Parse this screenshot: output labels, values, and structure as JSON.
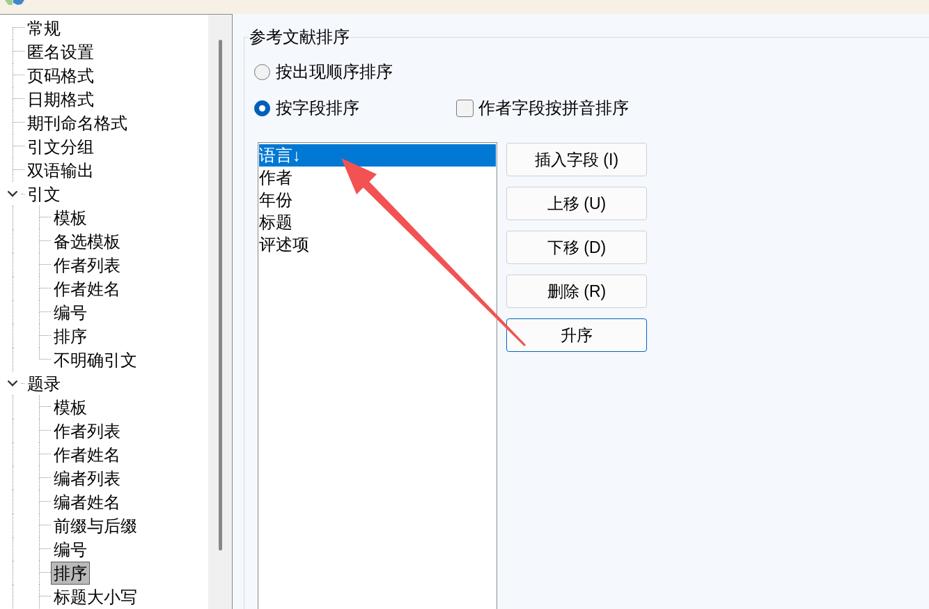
{
  "tree": {
    "items": [
      {
        "label": "常规",
        "selected": false
      },
      {
        "label": "匿名设置",
        "selected": false
      },
      {
        "label": "页码格式",
        "selected": false
      },
      {
        "label": "日期格式",
        "selected": false
      },
      {
        "label": "期刊命名格式",
        "selected": false
      },
      {
        "label": "引文分组",
        "selected": false
      },
      {
        "label": "双语输出",
        "selected": false
      },
      {
        "label": "引文",
        "selected": false,
        "expanded": true,
        "children": [
          {
            "label": "模板",
            "selected": false
          },
          {
            "label": "备选模板",
            "selected": false
          },
          {
            "label": "作者列表",
            "selected": false
          },
          {
            "label": "作者姓名",
            "selected": false
          },
          {
            "label": "编号",
            "selected": false
          },
          {
            "label": "排序",
            "selected": false
          },
          {
            "label": "不明确引文",
            "selected": false
          }
        ]
      },
      {
        "label": "题录",
        "selected": false,
        "expanded": true,
        "children": [
          {
            "label": "模板",
            "selected": false
          },
          {
            "label": "作者列表",
            "selected": false
          },
          {
            "label": "作者姓名",
            "selected": false
          },
          {
            "label": "编者列表",
            "selected": false
          },
          {
            "label": "编者姓名",
            "selected": false
          },
          {
            "label": "前缀与后缀",
            "selected": false
          },
          {
            "label": "编号",
            "selected": false
          },
          {
            "label": "排序",
            "selected": true
          },
          {
            "label": "标题大小写",
            "selected": false
          }
        ]
      }
    ]
  },
  "sort_group": {
    "title": "参考文献排序",
    "options": [
      {
        "label": "按出现顺序排序",
        "selected": false
      },
      {
        "label": "按字段排序",
        "selected": true
      }
    ],
    "pinyin_checkbox": {
      "label": "作者字段按拼音排序",
      "checked": false
    },
    "fields": [
      {
        "label": "语言↓",
        "selected": true
      },
      {
        "label": "作者",
        "selected": false
      },
      {
        "label": "年份",
        "selected": false
      },
      {
        "label": "标题",
        "selected": false
      },
      {
        "label": "评述项",
        "selected": false
      }
    ],
    "buttons": [
      {
        "label": "插入字段 (I)",
        "focused": false
      },
      {
        "label": "上移 (U)",
        "focused": false
      },
      {
        "label": "下移 (D)",
        "focused": false
      },
      {
        "label": "删除 (R)",
        "focused": false
      },
      {
        "label": "升序",
        "focused": true
      }
    ]
  }
}
